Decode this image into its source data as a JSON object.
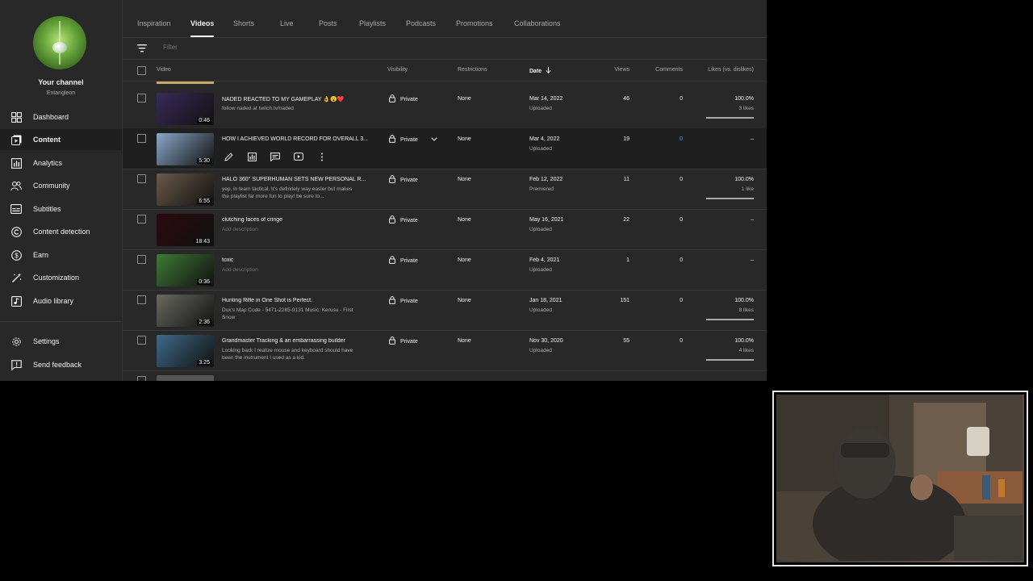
{
  "channel": {
    "name": "Your channel",
    "handle": "Entangleon"
  },
  "sidebar": {
    "items": [
      {
        "label": "Dashboard",
        "icon": "dashboard-icon",
        "active": false
      },
      {
        "label": "Content",
        "icon": "content-icon",
        "active": true
      },
      {
        "label": "Analytics",
        "icon": "analytics-icon",
        "active": false
      },
      {
        "label": "Community",
        "icon": "community-icon",
        "active": false
      },
      {
        "label": "Subtitles",
        "icon": "subtitles-icon",
        "active": false
      },
      {
        "label": "Content detection",
        "icon": "copyright-icon",
        "active": false
      },
      {
        "label": "Earn",
        "icon": "earn-icon",
        "active": false
      },
      {
        "label": "Customization",
        "icon": "magic-wand-icon",
        "active": false
      },
      {
        "label": "Audio library",
        "icon": "audio-library-icon",
        "active": false
      }
    ],
    "footer": [
      {
        "label": "Settings",
        "icon": "gear-icon"
      },
      {
        "label": "Send feedback",
        "icon": "feedback-icon"
      }
    ]
  },
  "tabs": [
    "Inspiration",
    "Videos",
    "Shorts",
    "Live",
    "Posts",
    "Playlists",
    "Podcasts",
    "Promotions",
    "Collaborations"
  ],
  "active_tab": "Videos",
  "filter": {
    "placeholder": "Filter"
  },
  "table": {
    "headers": {
      "video": "Video",
      "visibility": "Visibility",
      "restrictions": "Restrictions",
      "date": "Date",
      "views": "Views",
      "comments": "Comments",
      "likes": "Likes (vs. dislikes)"
    },
    "rows": [
      {
        "title": "NADED REACTED TO MY GAMEPLAY 👌😮❤️",
        "description": "follow naded at twitch.tv/naded",
        "duration": "0:46",
        "visibility": "Private",
        "restrictions": "None",
        "date": "Mar 14, 2022",
        "status": "Uploaded",
        "views": "46",
        "comments": "0",
        "likes": "100.0%",
        "likes_count": "3 likes",
        "likes_ratio": 1.0
      },
      {
        "title": "HOW I ACHIEVED WORLD RECORD FOR OVERALL 3...",
        "description": "",
        "duration": "5:30",
        "visibility": "Private",
        "restrictions": "None",
        "date": "Mar 4, 2022",
        "status": "Uploaded",
        "views": "19",
        "comments": "0",
        "likes": "–",
        "likes_count": "",
        "hover": true
      },
      {
        "title": "HALO 360° SUPERHUMAN SETS NEW PERSONAL R...",
        "description": "yep, in team tactical. It's definitely way easier but makes the playlist far more fun to play! be sure to...",
        "duration": "6:55",
        "visibility": "Private",
        "restrictions": "None",
        "date": "Feb 12, 2022",
        "status": "Premiered",
        "views": "11",
        "comments": "0",
        "likes": "100.0%",
        "likes_count": "1 like",
        "likes_ratio": 1.0
      },
      {
        "title": "clutching faces of cringe",
        "description": "Add description",
        "description_placeholder": true,
        "duration": "18:43",
        "visibility": "Private",
        "restrictions": "None",
        "date": "May 16, 2021",
        "status": "Uploaded",
        "views": "22",
        "comments": "0",
        "likes": "–",
        "likes_count": ""
      },
      {
        "title": "toxic",
        "description": "Add description",
        "description_placeholder": true,
        "duration": "0:36",
        "visibility": "Private",
        "restrictions": "None",
        "date": "Feb 4, 2021",
        "status": "Uploaded",
        "views": "1",
        "comments": "0",
        "likes": "–",
        "likes_count": ""
      },
      {
        "title": "Hunting Rifle in One Shot is Perfect.",
        "description": "Dux's Map Code - 5471-2285-9131 Music: Kerusu - First Snow",
        "duration": "2:36",
        "visibility": "Private",
        "restrictions": "None",
        "date": "Jan 18, 2021",
        "status": "Uploaded",
        "views": "151",
        "comments": "0",
        "likes": "100.0%",
        "likes_count": "8 likes",
        "likes_ratio": 1.0
      },
      {
        "title": "Grandmaster Tracking & an embarrassing builder",
        "description": "Looking back I realize mouse and keyboard should have been the instrument I used as a kid.",
        "duration": "3:25",
        "visibility": "Private",
        "restrictions": "None",
        "date": "Nov 30, 2020",
        "status": "Uploaded",
        "views": "55",
        "comments": "0",
        "likes": "100.0%",
        "likes_count": "4 likes",
        "likes_ratio": 1.0
      }
    ]
  },
  "thumb_colors": [
    "#3a2a5a",
    "#8aa7c9",
    "#6a5a4a",
    "#2a0a10",
    "#3f7a35",
    "#6a6a62",
    "#3f6a8a"
  ]
}
